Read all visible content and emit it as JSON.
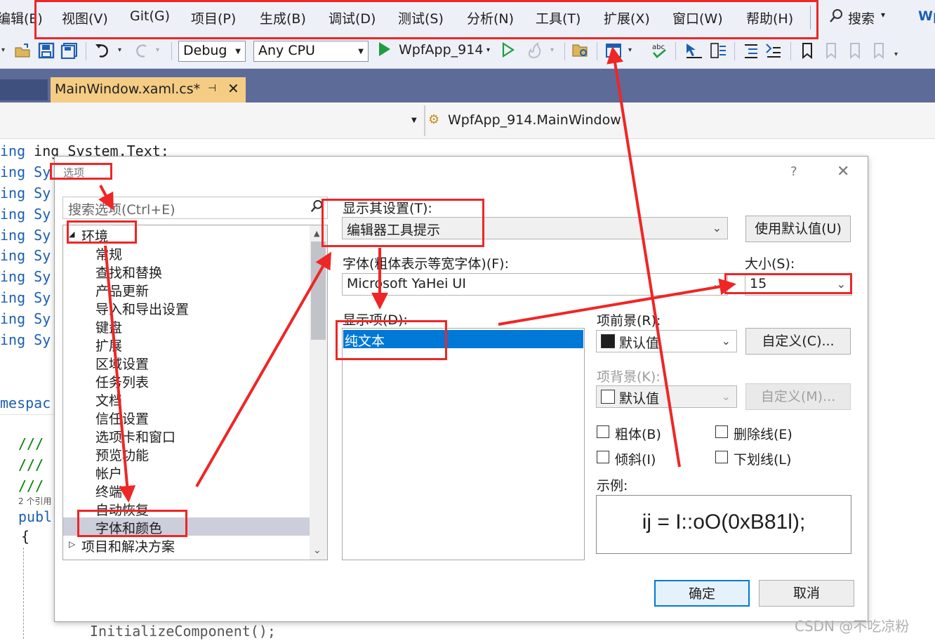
{
  "menubar": {
    "items": [
      "编辑(E)",
      "视图(V)",
      "Git(G)",
      "项目(P)",
      "生成(B)",
      "调试(D)",
      "测试(S)",
      "分析(N)",
      "工具(T)",
      "扩展(X)",
      "窗口(W)",
      "帮助(H)"
    ],
    "search_label": "搜索",
    "cut_text": "Wp"
  },
  "toolbar": {
    "config": "Debug",
    "platform": "Any CPU",
    "run_target": "WpfApp_914",
    "icons": [
      "new-folder-icon",
      "save-icon",
      "save-all-icon",
      "undo-icon",
      "redo-icon",
      "start-without-debug-icon",
      "hot-reload-icon",
      "solution-explorer-icon",
      "spell-check-icon",
      "indent-icon",
      "bookmark-icon"
    ]
  },
  "tabs": {
    "active_title": "MainWindow.xaml.cs*",
    "pin": "⊣",
    "close": "✕"
  },
  "navbar": {
    "class_name": "WpfApp_914.MainWindow"
  },
  "code": {
    "using_lines": [
      "ing System.Text;",
      "ing Sy",
      "ing Sy",
      "ing Sy",
      "ing Sy",
      "ing Sy",
      "ing Sy",
      "ing Sy",
      "ing Sy",
      "ing Sy"
    ],
    "namespace_text": "mespac",
    "comment_lines": [
      "///",
      "///",
      "///"
    ],
    "refs_text": "2 个引用",
    "public_text": "publ",
    "brace": "{",
    "init_line": "InitializeComponent();"
  },
  "dialog": {
    "title": "选项",
    "help": "?",
    "close": "✕",
    "search_placeholder": "搜索选项(Ctrl+E)",
    "tree": {
      "root": "环境",
      "children": [
        "常规",
        "查找和替换",
        "产品更新",
        "导入和导出设置",
        "键盘",
        "扩展",
        "区域设置",
        "任务列表",
        "文档",
        "信任设置",
        "选项卡和窗口",
        "预览功能",
        "帐户",
        "终端",
        "自动恢复",
        "字体和颜色"
      ],
      "selected": "字体和颜色",
      "next_root": "项目和解决方案"
    },
    "show_settings_label": "显示其设置(T):",
    "show_settings_value": "编辑器工具提示",
    "use_default_button": "使用默认值(U)",
    "font_label": "字体(粗体表示等宽字体)(F):",
    "font_value": "Microsoft YaHei UI",
    "size_label": "大小(S):",
    "size_value": "15",
    "display_items_label": "显示项(D):",
    "display_items": [
      "纯文本"
    ],
    "fg_label": "项前景(R):",
    "fg_value": "默认值",
    "fg_custom_button": "自定义(C)...",
    "bg_label": "项背景(K):",
    "bg_value": "默认值",
    "bg_custom_button": "自定义(M)...",
    "bold_label": "粗体(B)",
    "strike_label": "删除线(E)",
    "italic_label": "倾斜(I)",
    "underline_label": "下划线(L)",
    "sample_label": "示例:",
    "sample_text": "ij = I::oO(0xB81l);",
    "ok_button": "确定",
    "cancel_button": "取消"
  },
  "watermark": "CSDN @不吃凉粉",
  "colors": {
    "annotation_red": "#ee2626",
    "selection_blue": "#0078d7",
    "tab_active": "#f5cc84",
    "tab_strip": "#5d6b99"
  }
}
